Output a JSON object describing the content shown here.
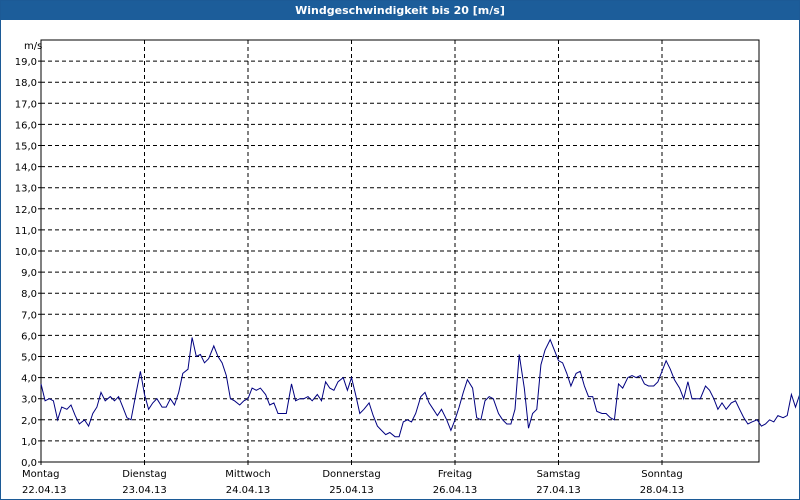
{
  "window": {
    "title": "Windgeschwindigkeit bis 20 [m/s]",
    "colors": {
      "titlebar": "#1c5d9a",
      "series": "#000080",
      "grid": "#000000"
    }
  },
  "chart_data": {
    "type": "line",
    "title": "Windgeschwindigkeit bis 20 [m/s]",
    "ylabel": "m/s",
    "ylim": [
      0,
      20
    ],
    "xlim_days": [
      0,
      7
    ],
    "grid": true,
    "y_ticks": [
      "0,0",
      "1,0",
      "2,0",
      "3,0",
      "4,0",
      "5,0",
      "6,0",
      "7,0",
      "8,0",
      "9,0",
      "10,0",
      "11,0",
      "12,0",
      "13,0",
      "14,0",
      "15,0",
      "16,0",
      "17,0",
      "18,0",
      "19,0"
    ],
    "x_ticks": [
      {
        "day": "Montag",
        "date": "22.04.13"
      },
      {
        "day": "Dienstag",
        "date": "23.04.13"
      },
      {
        "day": "Mittwoch",
        "date": "24.04.13"
      },
      {
        "day": "Donnerstag",
        "date": "25.04.13"
      },
      {
        "day": "Freitag",
        "date": "26.04.13"
      },
      {
        "day": "Samstag",
        "date": "27.04.13"
      },
      {
        "day": "Sonntag",
        "date": "28.04.13"
      }
    ],
    "series": [
      {
        "points": [
          [
            0.0,
            3.7
          ],
          [
            0.04,
            2.9
          ],
          [
            0.08,
            3.0
          ],
          [
            0.12,
            2.9
          ],
          [
            0.16,
            2.0
          ],
          [
            0.2,
            2.6
          ],
          [
            0.25,
            2.5
          ],
          [
            0.29,
            2.7
          ],
          [
            0.33,
            2.2
          ],
          [
            0.37,
            1.8
          ],
          [
            0.42,
            2.0
          ],
          [
            0.46,
            1.7
          ],
          [
            0.5,
            2.3
          ],
          [
            0.54,
            2.6
          ],
          [
            0.58,
            3.3
          ],
          [
            0.62,
            2.9
          ],
          [
            0.67,
            3.1
          ],
          [
            0.71,
            2.9
          ],
          [
            0.75,
            3.1
          ],
          [
            0.79,
            2.6
          ],
          [
            0.83,
            2.1
          ],
          [
            0.87,
            2.0
          ],
          [
            0.92,
            3.3
          ],
          [
            0.96,
            4.3
          ],
          [
            1.0,
            3.2
          ],
          [
            1.04,
            2.5
          ],
          [
            1.08,
            2.8
          ],
          [
            1.12,
            3.0
          ],
          [
            1.17,
            2.6
          ],
          [
            1.21,
            2.6
          ],
          [
            1.25,
            3.0
          ],
          [
            1.29,
            2.7
          ],
          [
            1.33,
            3.3
          ],
          [
            1.37,
            4.2
          ],
          [
            1.42,
            4.4
          ],
          [
            1.46,
            5.9
          ],
          [
            1.5,
            5.0
          ],
          [
            1.54,
            5.1
          ],
          [
            1.58,
            4.7
          ],
          [
            1.62,
            4.9
          ],
          [
            1.67,
            5.5
          ],
          [
            1.71,
            5.0
          ],
          [
            1.75,
            4.7
          ],
          [
            1.79,
            4.1
          ],
          [
            1.83,
            3.0
          ],
          [
            1.87,
            2.9
          ],
          [
            1.92,
            2.7
          ],
          [
            1.96,
            2.9
          ],
          [
            2.0,
            3.0
          ],
          [
            2.04,
            3.5
          ],
          [
            2.08,
            3.4
          ],
          [
            2.12,
            3.5
          ],
          [
            2.17,
            3.2
          ],
          [
            2.21,
            2.7
          ],
          [
            2.25,
            2.8
          ],
          [
            2.29,
            2.3
          ],
          [
            2.33,
            2.3
          ],
          [
            2.37,
            2.3
          ],
          [
            2.42,
            3.7
          ],
          [
            2.46,
            2.9
          ],
          [
            2.5,
            3.0
          ],
          [
            2.54,
            3.0
          ],
          [
            2.58,
            3.1
          ],
          [
            2.62,
            2.9
          ],
          [
            2.67,
            3.2
          ],
          [
            2.71,
            2.9
          ],
          [
            2.75,
            3.8
          ],
          [
            2.79,
            3.5
          ],
          [
            2.83,
            3.4
          ],
          [
            2.87,
            3.8
          ],
          [
            2.92,
            4.0
          ],
          [
            2.96,
            3.4
          ],
          [
            3.0,
            4.0
          ],
          [
            3.04,
            3.2
          ],
          [
            3.08,
            2.3
          ],
          [
            3.12,
            2.5
          ],
          [
            3.17,
            2.8
          ],
          [
            3.21,
            2.2
          ],
          [
            3.25,
            1.7
          ],
          [
            3.29,
            1.5
          ],
          [
            3.33,
            1.3
          ],
          [
            3.37,
            1.4
          ],
          [
            3.42,
            1.2
          ],
          [
            3.46,
            1.2
          ],
          [
            3.5,
            1.9
          ],
          [
            3.54,
            2.0
          ],
          [
            3.58,
            1.9
          ],
          [
            3.62,
            2.3
          ],
          [
            3.67,
            3.1
          ],
          [
            3.71,
            3.3
          ],
          [
            3.75,
            2.8
          ],
          [
            3.79,
            2.5
          ],
          [
            3.83,
            2.2
          ],
          [
            3.87,
            2.5
          ],
          [
            3.92,
            2.0
          ],
          [
            3.96,
            1.5
          ],
          [
            4.0,
            2.0
          ],
          [
            4.04,
            2.6
          ],
          [
            4.08,
            3.3
          ],
          [
            4.12,
            3.9
          ],
          [
            4.17,
            3.5
          ],
          [
            4.21,
            2.1
          ],
          [
            4.25,
            2.0
          ],
          [
            4.29,
            2.9
          ],
          [
            4.33,
            3.1
          ],
          [
            4.37,
            3.0
          ],
          [
            4.42,
            2.3
          ],
          [
            4.46,
            2.0
          ],
          [
            4.5,
            1.8
          ],
          [
            4.54,
            1.8
          ],
          [
            4.58,
            2.5
          ],
          [
            4.62,
            5.1
          ],
          [
            4.67,
            3.5
          ],
          [
            4.71,
            1.6
          ],
          [
            4.75,
            2.3
          ],
          [
            4.79,
            2.5
          ],
          [
            4.83,
            4.6
          ],
          [
            4.87,
            5.3
          ],
          [
            4.92,
            5.8
          ],
          [
            4.96,
            5.3
          ],
          [
            5.0,
            4.8
          ],
          [
            5.04,
            4.7
          ],
          [
            5.08,
            4.2
          ],
          [
            5.12,
            3.6
          ],
          [
            5.17,
            4.2
          ],
          [
            5.21,
            4.3
          ],
          [
            5.25,
            3.6
          ],
          [
            5.29,
            3.1
          ],
          [
            5.33,
            3.1
          ],
          [
            5.37,
            2.4
          ],
          [
            5.42,
            2.3
          ],
          [
            5.46,
            2.3
          ],
          [
            5.5,
            2.1
          ],
          [
            5.54,
            2.0
          ],
          [
            5.58,
            3.7
          ],
          [
            5.62,
            3.5
          ],
          [
            5.67,
            4.0
          ],
          [
            5.71,
            4.1
          ],
          [
            5.75,
            4.0
          ],
          [
            5.79,
            4.1
          ],
          [
            5.83,
            3.7
          ],
          [
            5.87,
            3.6
          ],
          [
            5.92,
            3.6
          ],
          [
            5.96,
            3.8
          ],
          [
            6.0,
            4.3
          ],
          [
            6.04,
            4.8
          ],
          [
            6.08,
            4.4
          ],
          [
            6.12,
            3.9
          ],
          [
            6.17,
            3.5
          ],
          [
            6.21,
            3.0
          ],
          [
            6.25,
            3.8
          ],
          [
            6.29,
            3.0
          ],
          [
            6.33,
            3.0
          ],
          [
            6.37,
            3.0
          ],
          [
            6.42,
            3.6
          ],
          [
            6.46,
            3.4
          ],
          [
            6.5,
            3.0
          ],
          [
            6.54,
            2.5
          ],
          [
            6.58,
            2.8
          ],
          [
            6.62,
            2.5
          ],
          [
            6.67,
            2.8
          ],
          [
            6.71,
            2.9
          ],
          [
            6.75,
            2.5
          ],
          [
            6.79,
            2.1
          ],
          [
            6.83,
            1.8
          ],
          [
            6.87,
            1.9
          ],
          [
            6.92,
            2.0
          ],
          [
            6.96,
            1.7
          ],
          [
            7.0,
            1.8
          ],
          [
            7.04,
            2.0
          ],
          [
            7.08,
            1.9
          ],
          [
            7.12,
            2.2
          ],
          [
            7.17,
            2.1
          ],
          [
            7.21,
            2.2
          ],
          [
            7.25,
            3.2
          ],
          [
            7.29,
            2.6
          ],
          [
            7.33,
            3.2
          ],
          [
            7.37,
            2.9
          ],
          [
            7.42,
            1.9
          ],
          [
            7.46,
            1.5
          ],
          [
            7.5,
            1.9
          ]
        ]
      }
    ]
  }
}
